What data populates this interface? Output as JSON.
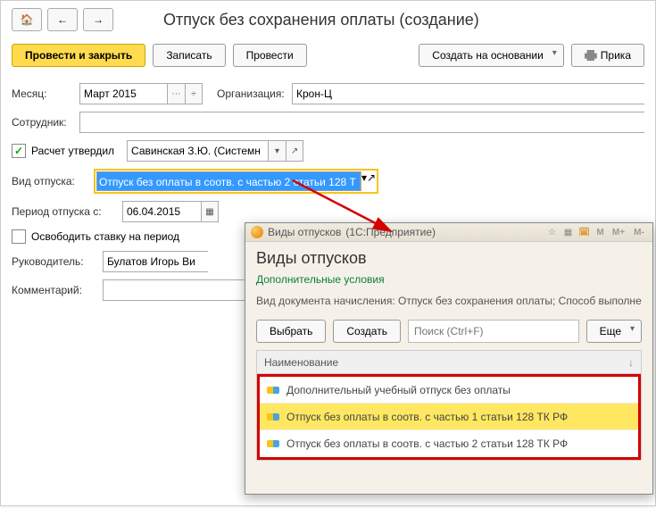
{
  "header": {
    "title": "Отпуск без сохранения оплаты (создание)"
  },
  "toolbar": {
    "primary": "Провести и закрыть",
    "save": "Записать",
    "post": "Провести",
    "create_based": "Создать на основании",
    "print": "Прика"
  },
  "form": {
    "month_lbl": "Месяц:",
    "month_val": "Март 2015",
    "org_lbl": "Организация:",
    "org_val": "Крон-Ц",
    "employee_lbl": "Сотрудник:",
    "employee_val": "",
    "calc_lbl": "Расчет утвердил",
    "approver_val": "Савинская З.Ю. (Системн",
    "leave_type_lbl": "Вид отпуска:",
    "leave_type_val": "Отпуск без оплаты в соотв. с частью 2 статьи 128 Т",
    "period_lbl": "Период отпуска с:",
    "period_val": "06.04.2015",
    "release_lbl": "Освободить ставку на период",
    "manager_lbl": "Руководитель:",
    "manager_val": "Булатов Игорь Ви",
    "comment_lbl": "Комментарий:",
    "comment_val": ""
  },
  "popup": {
    "win_title": "Виды отпусков",
    "win_sub": "(1С:Предприятие)",
    "memory_btns": [
      "M",
      "M+",
      "M-"
    ],
    "h1": "Виды отпусков",
    "sub": "Дополнительные условия",
    "info": "Вид документа начисления: Отпуск без сохранения оплаты; Способ выполне",
    "select_btn": "Выбрать",
    "create_btn": "Создать",
    "search_ph": "Поиск (Ctrl+F)",
    "more_btn": "Еще",
    "col_name": "Наименование",
    "rows": [
      "Дополнительный учебный отпуск без оплаты",
      "Отпуск без оплаты в соотв. с частью 1 статьи 128 ТК РФ",
      "Отпуск без оплаты в соотв. с частью 2 статьи 128 ТК РФ"
    ]
  }
}
